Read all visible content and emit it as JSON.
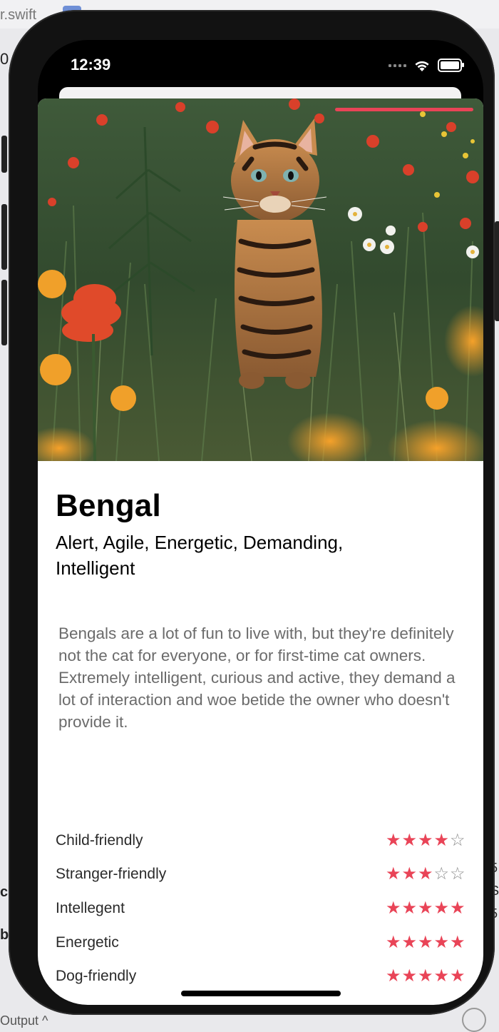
{
  "host": {
    "file_fragment": "r.swift",
    "gutter_fragment": "0",
    "bottom_fragment": "Output ^",
    "right_marks": [
      "5",
      "S",
      "5",
      "-"
    ],
    "left_marks": [
      "c",
      "b"
    ]
  },
  "status_bar": {
    "time": "12:39"
  },
  "breed": {
    "name": "Bengal",
    "temperament": "Alert, Agile, Energetic, Demanding, Intelligent",
    "description": "Bengals are a lot of fun to live with, but they're definitely not the cat for everyone, or for first-time cat owners. Extremely intelligent, curious and active, they demand a lot of interaction and woe betide the owner who doesn't provide it.",
    "photo_progress": 0.31
  },
  "ratings": [
    {
      "label": "Child-friendly",
      "value": 4,
      "max": 5
    },
    {
      "label": "Stranger-friendly",
      "value": 3,
      "max": 5
    },
    {
      "label": "Intellegent",
      "value": 5,
      "max": 5
    },
    {
      "label": "Energetic",
      "value": 5,
      "max": 5
    },
    {
      "label": "Dog-friendly",
      "value": 5,
      "max": 5
    }
  ],
  "colors": {
    "accent": "#e94457",
    "star_empty": "#8e8e8e",
    "phone_frame": "#121212"
  }
}
